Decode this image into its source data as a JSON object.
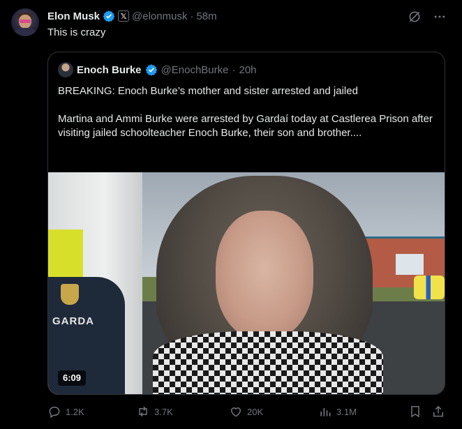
{
  "post": {
    "author_name": "Elon Musk",
    "handle": "@elonmusk",
    "time": "58m",
    "text": "This is crazy",
    "badge_letter": "𝕏"
  },
  "quote": {
    "author_name": "Enoch Burke",
    "handle": "@EnochBurke",
    "time": "20h",
    "headline": "BREAKING: Enoch Burke’s mother and sister arrested and jailed",
    "body": "Martina and Ammi Burke were arrested by Gardaí today at Castlerea Prison after visiting jailed schoolteacher Enoch Burke, their son and brother....",
    "video_duration": "6:09",
    "video_overlay_text": "GARDA"
  },
  "actions": {
    "replies": "1.2K",
    "reposts": "3.7K",
    "likes": "20K",
    "views": "3.1M"
  },
  "icons": {
    "verified": "verified-check-icon",
    "grok": "grok-icon",
    "more": "more-icon",
    "reply": "reply-icon",
    "repost": "repost-icon",
    "like": "heart-icon",
    "views": "views-icon",
    "bookmark": "bookmark-icon",
    "share": "share-icon"
  },
  "colors": {
    "background": "#000000",
    "text": "#e7e9ea",
    "muted": "#71767b",
    "verified_blue": "#1d9bf0",
    "border": "#2f3336"
  }
}
